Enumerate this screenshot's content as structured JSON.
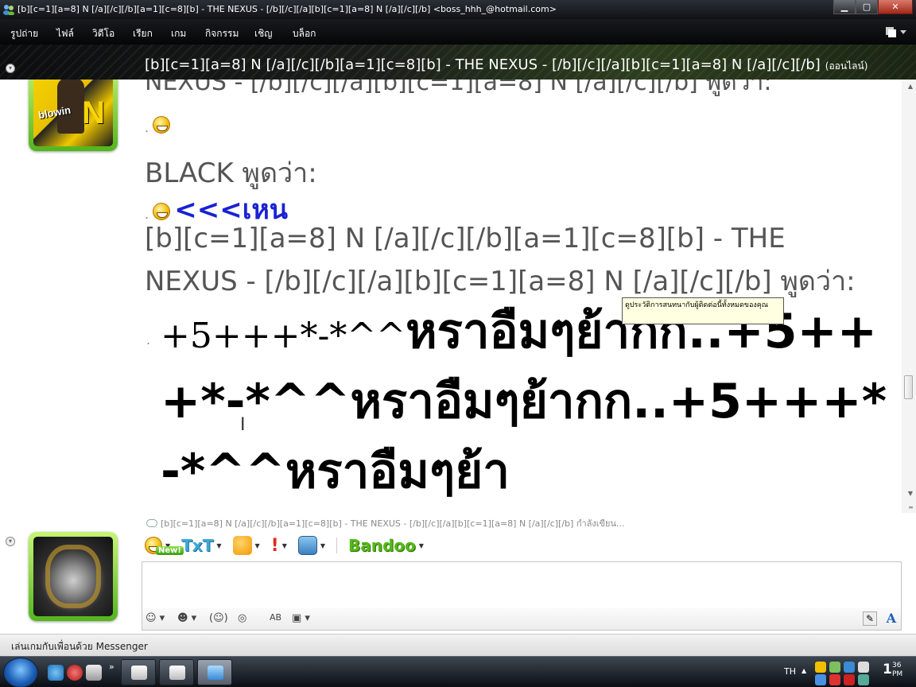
{
  "window": {
    "title": "[b][c=1][a=8] N [/a][/c][/b][a=1][c=8][b] - THE NEXUS - [/b][/c][/a][b][c=1][a=8] N [/a][/c][/b] <boss_hhh_@hotmail.com>",
    "min_label": "▁",
    "max_label": "▢",
    "close_label": "✕"
  },
  "menu": {
    "items": [
      "รูปถ่าย",
      "ไฟล์",
      "วิดีโอ",
      "เรียก",
      "เกม",
      "กิจกรรม",
      "เชิญ",
      "บล็อก"
    ],
    "right_icon": "layout-menu-icon"
  },
  "header": {
    "contact": "[b][c=1][a=8] N [/a][/c][/b][a=1][c=8][b] - THE NEXUS - [/b][/c][/a][b][c=1][a=8] N [/a][/c][/b]",
    "status": "(ออนไลน์)"
  },
  "chat": {
    "top_cut": "NEXUS - [/b][/c][/a][b][c=1][a=8] N [/a][/c][/b] พูดว่า:",
    "msg1_dot": ".",
    "msg2_sender": "BLACK พูดว่า:",
    "msg2_dot": ".",
    "msg2_text": "<<<เหน",
    "msg3_sender_line1": "[b][c=1][a=8] N [/a][/c][/b][a=1][c=8][b] - THE",
    "msg3_sender_line2": "NEXUS - [/b][/c][/a][b][c=1][a=8] N [/a][/c][/b] พูดว่า:",
    "msg3_dot": ".",
    "msg3_text_serif": "+5+++*-*^^",
    "msg3_text_bold": "หราอืมๆย้ากก..+5+++*-*^^หราอืมๆย้ากก..+5+++*-*^^หราอืมๆย้า",
    "tooltip": "ดูประวัติการสนทนากับผู้ติดต่อนี้ทั้งหมดของคุณ"
  },
  "compose": {
    "typing_status": "[b][c=1][a=8] N [/a][/c][/b][a=1][c=8][b] - THE NEXUS - [/b][/c][/a][b][c=1][a=8] N [/a][/c][/b] กำลังเขียน...",
    "new_badge": "New!",
    "txt_label": "TxT",
    "bandoo_label": "Bandoo",
    "value": "",
    "ab_label": "AB"
  },
  "games_bar": "เล่นเกมกับเพื่อนด้วย Messenger",
  "taskbar": {
    "lang": "TH",
    "ql_more": "»",
    "clock_hour": "1",
    "clock_min": "36",
    "clock_ampm": "PM"
  },
  "colors": {
    "avatar_frame": "#7fd63a",
    "link_blue": "#1a22d4",
    "header_green": "#2d3f1e"
  }
}
